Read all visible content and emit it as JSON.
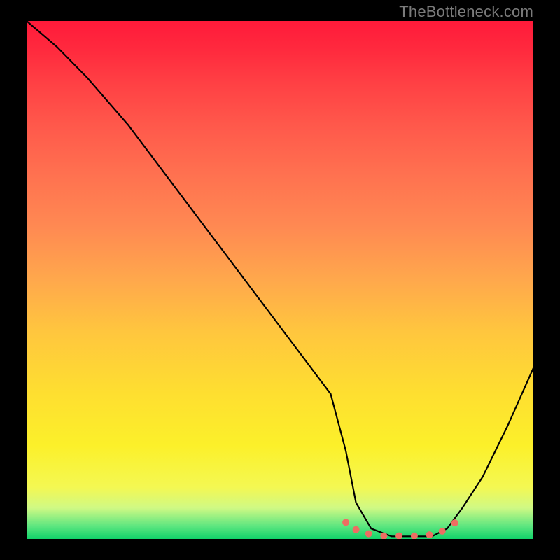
{
  "watermark": "TheBottleneck.com",
  "chart_data": {
    "type": "line",
    "title": "",
    "xlabel": "",
    "ylabel": "",
    "xlim": [
      0,
      100
    ],
    "ylim": [
      0,
      100
    ],
    "series": [
      {
        "name": "bottleneck-curve",
        "x": [
          0,
          6,
          12,
          20,
          30,
          40,
          50,
          60,
          63,
          65,
          68,
          72,
          76,
          80,
          83,
          86,
          90,
          95,
          100
        ],
        "values": [
          100,
          95,
          89,
          80,
          67,
          54,
          41,
          28,
          17,
          7,
          2,
          0.5,
          0.5,
          0.5,
          2,
          6,
          12,
          22,
          33
        ]
      }
    ],
    "markers": {
      "name": "optimal-range-dots",
      "x": [
        63,
        65,
        67.5,
        70.5,
        73.5,
        76.5,
        79.5,
        82,
        84.5
      ],
      "values": [
        3.2,
        1.8,
        1.0,
        0.6,
        0.6,
        0.6,
        0.8,
        1.5,
        3.1
      ]
    },
    "gradient_stops": [
      {
        "pos": 0,
        "color": "#ff1a3a"
      },
      {
        "pos": 50,
        "color": "#ffa84c"
      },
      {
        "pos": 82,
        "color": "#fcf02a"
      },
      {
        "pos": 100,
        "color": "#11d36a"
      }
    ]
  }
}
